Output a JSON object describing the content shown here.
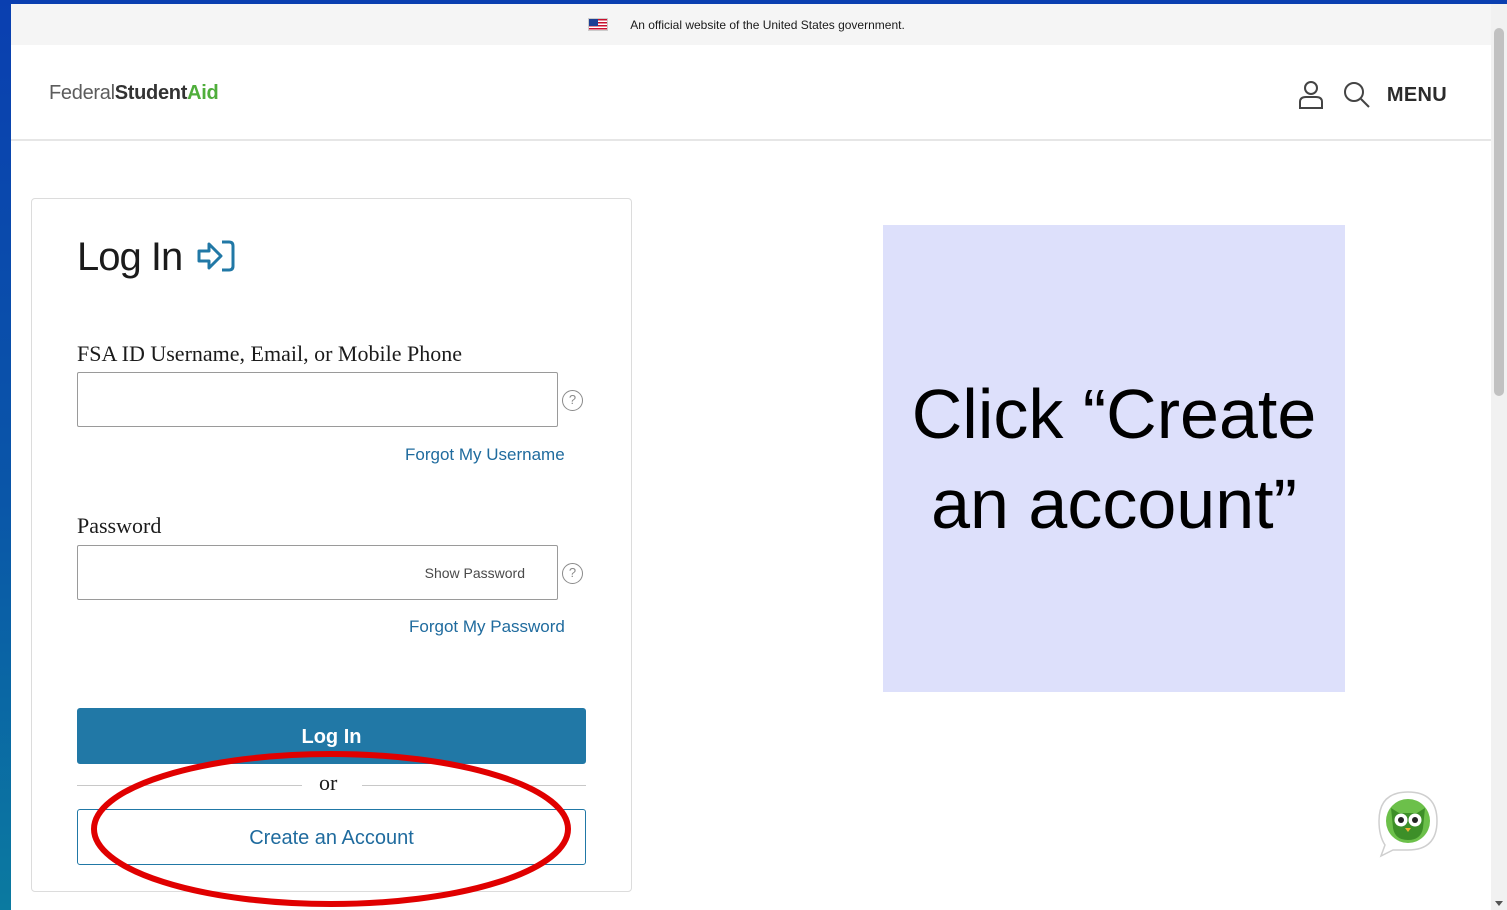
{
  "gov_banner": {
    "flag_icon": "us-flag-icon",
    "text": "An official website of the United States government."
  },
  "header": {
    "logo": {
      "part1": "Federal",
      "part2": "Student",
      "part3": "Aid"
    },
    "icons": [
      "user-icon",
      "search-icon"
    ],
    "menu_label": "MENU"
  },
  "login_card": {
    "title": "Log In",
    "title_icon": "login-arrow-icon",
    "username_label": "FSA ID Username, Email, or Mobile Phone",
    "username_value": "",
    "forgot_username": "Forgot My Username",
    "password_label": "Password",
    "password_value": "",
    "show_password": "Show Password",
    "forgot_password": "Forgot My Password",
    "login_button": "Log In",
    "or_text": "or",
    "create_account_button": "Create an Account",
    "help_glyph": "?"
  },
  "callout": {
    "text": "Click “Create an account”"
  },
  "chat": {
    "icon": "owl-chat-icon"
  },
  "colors": {
    "brand_blue": "#2178a6",
    "link_blue": "#1f6b9e",
    "aid_green": "#4fae3b",
    "callout_bg": "#dde0fb",
    "annotation_red": "#e00000",
    "slide_bg": "#0a3fb0"
  }
}
